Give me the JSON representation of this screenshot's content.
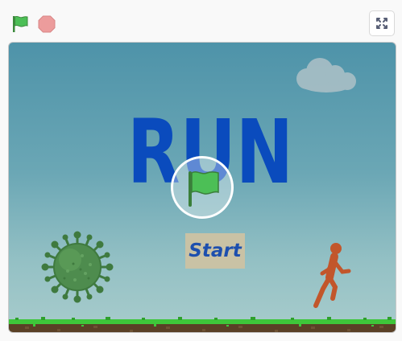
{
  "controls": {
    "green_flag_icon": "green-flag-icon",
    "stop_icon": "stop-icon",
    "fullscreen_icon": "fullscreen-icon"
  },
  "stage": {
    "title_text": "RUN",
    "start_label": "Start",
    "colors": {
      "title": "#0a4bbd",
      "start_text": "#1d4fae",
      "start_bg": "#c9c2a5",
      "grass": "#3ec63a",
      "dirt": "#5a4026",
      "runner": "#c2562b",
      "virus": "#4e8c4e"
    }
  }
}
